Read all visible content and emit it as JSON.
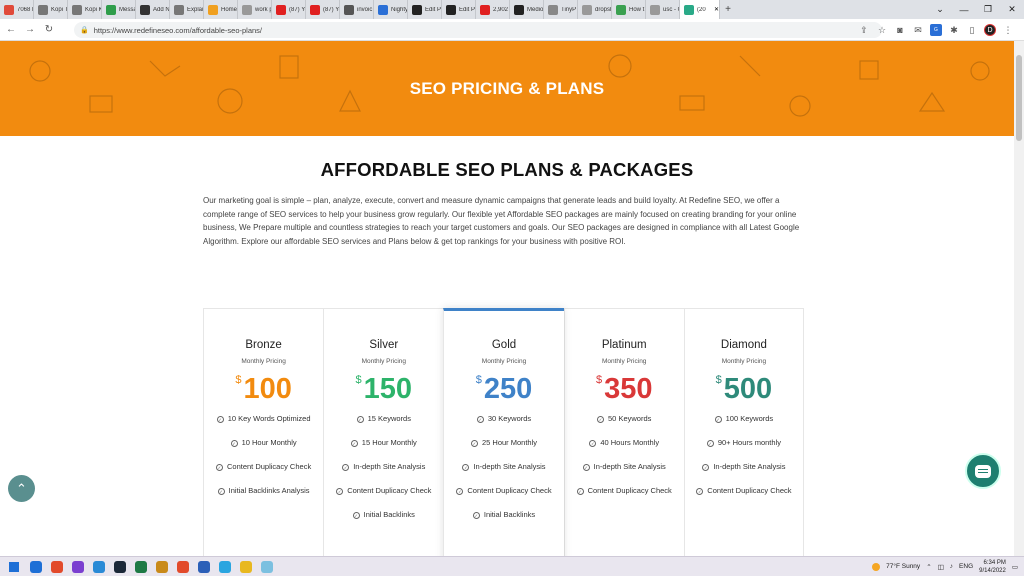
{
  "browser": {
    "tabs": [
      {
        "label": "7068 P",
        "color": "#e04a3a"
      },
      {
        "label": "Kopi To",
        "color": "#777777"
      },
      {
        "label": "Kopi Ka",
        "color": "#777777"
      },
      {
        "label": "Messa",
        "color": "#2e9d4a"
      },
      {
        "label": "Add N",
        "color": "#333333"
      },
      {
        "label": "Explai",
        "color": "#777777"
      },
      {
        "label": "Home",
        "color": "#f0a020"
      },
      {
        "label": "work p",
        "color": "#999999"
      },
      {
        "label": "(87) Yo",
        "color": "#e02020"
      },
      {
        "label": "(87) Yo",
        "color": "#e02020"
      },
      {
        "label": "invoic",
        "color": "#555555"
      },
      {
        "label": "Nighty",
        "color": "#2a6fd6"
      },
      {
        "label": "Edit Pc",
        "color": "#222222"
      },
      {
        "label": "Edit Pc",
        "color": "#222222"
      },
      {
        "label": "2,902 C",
        "color": "#e02020"
      },
      {
        "label": "Medio",
        "color": "#222222"
      },
      {
        "label": "TinyP",
        "color": "#888888"
      },
      {
        "label": "dropsh",
        "color": "#999999"
      },
      {
        "label": "How t",
        "color": "#3aa050"
      },
      {
        "label": "usc - G",
        "color": "#999999"
      },
      {
        "label": "(20",
        "color": "#2aaa88"
      }
    ],
    "url": "https://www.redefineseo.com/affordable-seo-plans/"
  },
  "page": {
    "hero_title": "SEO PRICING & PLANS",
    "section_title": "AFFORDABLE SEO PLANS & PACKAGES",
    "intro": "Our marketing goal is simple – plan, analyze, execute, convert and measure dynamic campaigns that generate leads and build loyalty. At Redefine SEO, we offer a complete range of SEO services to help your business grow regularly. Our flexible yet Affordable SEO packages are mainly focused on creating branding for your online business, We Prepare multiple and countless strategies to reach your target customers and goals. Our SEO packages are designed in compliance with all Latest Google Algorithm. Explore our affordable SEO services and Plans below & get top rankings for your business with positive ROI.",
    "plans": [
      {
        "name": "Bronze",
        "sub": "Monthly Pricing",
        "currency": "$",
        "price": "100",
        "color": "#f28b0f",
        "features": [
          "10 Key Words Optimized",
          "10 Hour Monthly",
          "Content Duplicacy Check",
          "Initial Backlinks Analysis"
        ]
      },
      {
        "name": "Silver",
        "sub": "Monthly Pricing",
        "currency": "$",
        "price": "150",
        "color": "#2db36a",
        "features": [
          "15 Keywords",
          "15 Hour Monthly",
          "In-depth Site Analysis",
          "Content Duplicacy Check",
          "Initial Backlinks"
        ]
      },
      {
        "name": "Gold",
        "sub": "Monthly Pricing",
        "currency": "$",
        "price": "250",
        "color": "#3f82c8",
        "features": [
          "30 Keywords",
          "25 Hour Monthly",
          "In-depth Site Analysis",
          "Content Duplicacy Check",
          "Initial Backlinks"
        ]
      },
      {
        "name": "Platinum",
        "sub": "Monthly Pricing",
        "currency": "$",
        "price": "350",
        "color": "#d93838",
        "features": [
          "50 Keywords",
          "40 Hours Monthly",
          "In-depth Site Analysis",
          "Content Duplicacy Check"
        ]
      },
      {
        "name": "Diamond",
        "sub": "Monthly Pricing",
        "currency": "$",
        "price": "500",
        "color": "#2e8a7a",
        "features": [
          "100 Keywords",
          "90+ Hours monthly",
          "In-depth Site Analysis",
          "Content Duplicacy Check"
        ]
      }
    ]
  },
  "taskbar": {
    "weather": "77°F  Sunny",
    "lang": "ENG",
    "time": "6:34 PM",
    "date": "9/14/2022",
    "apps": [
      "#1e6fd6",
      "#e24a2b",
      "#7b3fd0",
      "#2a8ad6",
      "#1b2838",
      "#1e7a45",
      "#c98a1a",
      "#e24a2b",
      "#2b5fb8",
      "#2aa5e0",
      "#e8b820",
      "#7cc0e0"
    ]
  }
}
